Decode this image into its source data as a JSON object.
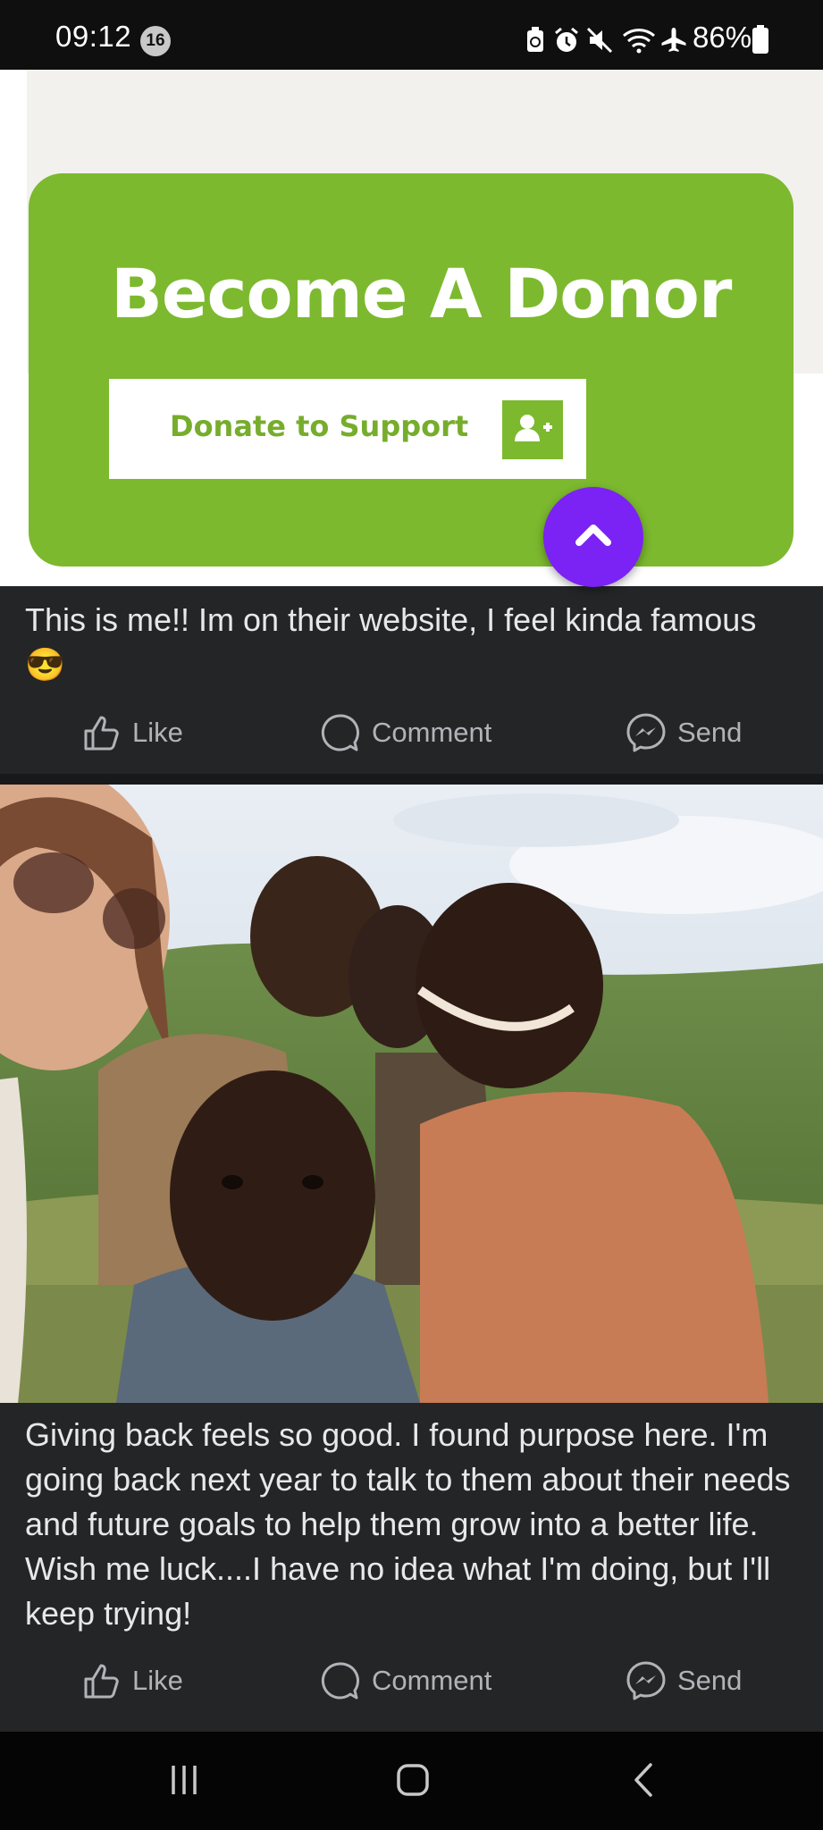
{
  "status_bar": {
    "time": "09:12",
    "notification_count": "16",
    "battery": "86%",
    "icons": [
      "battery-saver-icon",
      "alarm-icon",
      "mute-icon",
      "wifi-icon",
      "airplane-icon",
      "battery-icon"
    ]
  },
  "post1": {
    "image": {
      "heading": "Become A Donor",
      "button_label": "Donate to Support",
      "accent_color": "#7cb92e",
      "fab_color": "#7b22f4"
    },
    "caption": "This is me!! Im on their website, I feel kinda famous 😎",
    "actions": {
      "like": "Like",
      "comment": "Comment",
      "send": "Send"
    }
  },
  "post2": {
    "image_icon": "group-photo-children-selfie",
    "caption": "Giving back feels so good. I found purpose here. I'm going back next year to talk to them about their needs and future goals to help them grow into a better life. Wish me luck....I have no idea what I'm doing, but I'll keep trying!",
    "actions": {
      "like": "Like",
      "comment": "Comment",
      "send": "Send"
    }
  },
  "nav_bar": {
    "icons": [
      "recent-apps-icon",
      "home-icon",
      "back-icon"
    ]
  }
}
